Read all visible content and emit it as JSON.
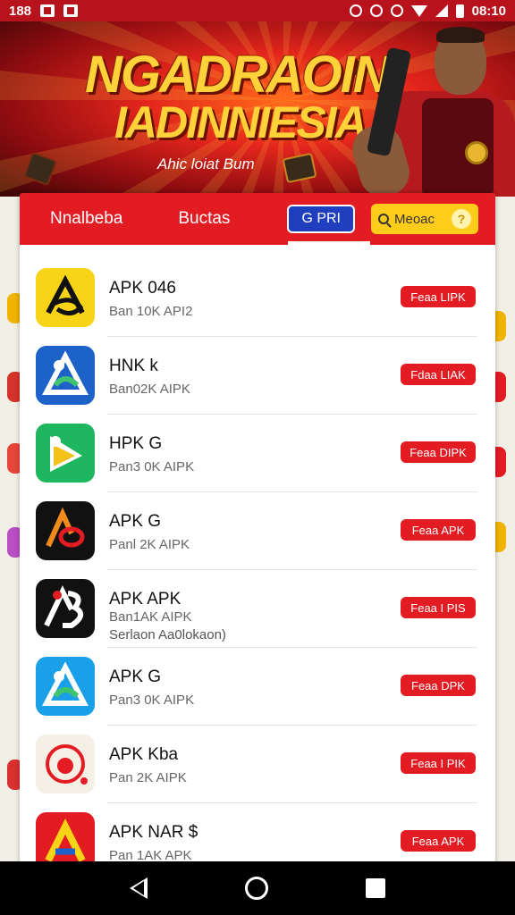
{
  "status_bar": {
    "left_text": "188",
    "time": "08:10"
  },
  "banner": {
    "title": "NGADRAOIN",
    "subtitle": "IADINNIESIA",
    "tagline": "Ahic loiat Bum"
  },
  "tabs": [
    {
      "label": "Nnalbeba"
    },
    {
      "label": "Buctas"
    },
    {
      "label": "G PRI"
    }
  ],
  "search": {
    "label": "Meoac"
  },
  "apps": [
    {
      "name": "APK 046",
      "sub": "Ban 10K API2",
      "sub2": "",
      "button": "Feaa LIPK",
      "icon": "apk-a-icon",
      "color": "#f7d417"
    },
    {
      "name": "HNK k",
      "sub": "Ban02K AIPK",
      "sub2": "",
      "button": "Fdaa LIAK",
      "icon": "triangle-logo-icon",
      "color": "#1d62c8"
    },
    {
      "name": "HPK G",
      "sub": "Pan3 0K AIPK",
      "sub2": "",
      "button": "Feaa DIPK",
      "icon": "play-triangle-icon",
      "color": "#1fb660"
    },
    {
      "name": "APK G",
      "sub": "Panl 2K AIPK",
      "sub2": "",
      "button": "Feaa APK",
      "icon": "chain-logo-icon",
      "color": "#111111"
    },
    {
      "name": "APK APK",
      "sub": "Ban1AK AIPK",
      "sub2": "Serlaon Aa0lokaon)",
      "button": "Feaa I PIS",
      "icon": "ab-logo-icon",
      "color": "#111111"
    },
    {
      "name": "APK G",
      "sub": "Pan3 0K AIPK",
      "sub2": "",
      "button": "Feaa DPK",
      "icon": "cloud-triangle-icon",
      "color": "#1aa0e8"
    },
    {
      "name": "APK Kba",
      "sub": "Pan 2K AIPK",
      "sub2": "",
      "button": "Feaa I PIK",
      "icon": "apple-circle-icon",
      "color": "#f5f0e6"
    },
    {
      "name": "APK NAR $",
      "sub": "Pan 1AK APK",
      "sub2": "",
      "button": "Feaa APK",
      "icon": "colorful-a-icon",
      "color": "#e31b22"
    }
  ],
  "colors": {
    "primary_red": "#e31b22",
    "tab_blue": "#1f3fbf",
    "search_yellow": "#ffcc1a"
  }
}
